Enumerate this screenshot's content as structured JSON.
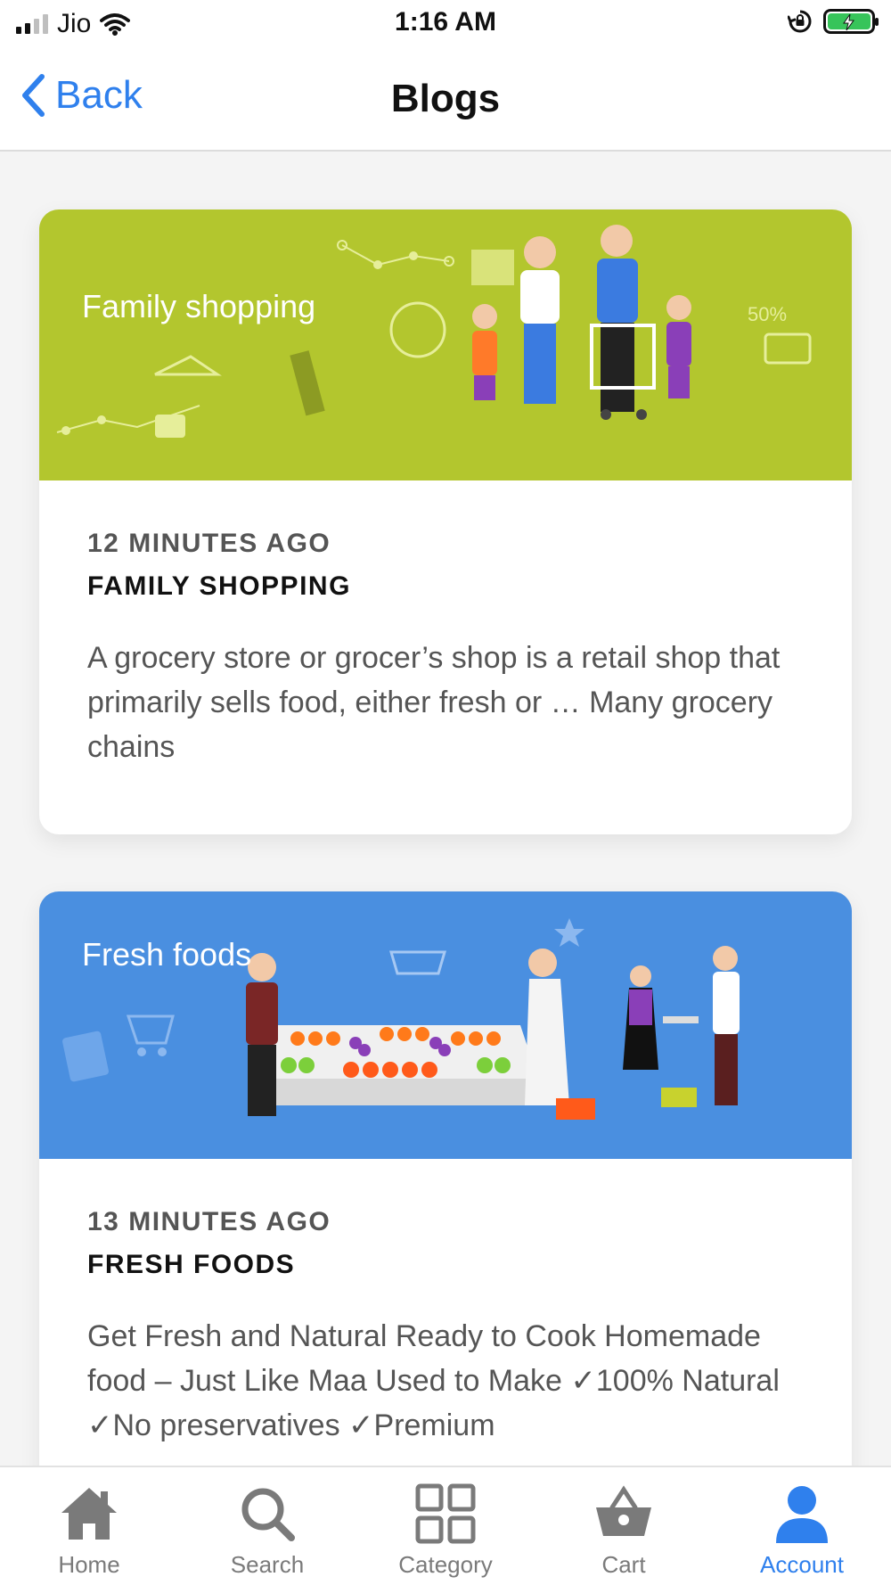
{
  "status_bar": {
    "carrier": "Jio",
    "time": "1:16 AM"
  },
  "nav": {
    "back_label": "Back",
    "title": "Blogs"
  },
  "posts": [
    {
      "banner_title": "Family shopping",
      "time_ago": "12 MINUTES AGO",
      "title": "FAMILY SHOPPING",
      "excerpt": "A grocery store or grocer’s shop is a retail shop that primarily sells food, either fresh or … Many grocery chains",
      "banner_color": "#b3c62e"
    },
    {
      "banner_title": "Fresh foods",
      "time_ago": "13 MINUTES AGO",
      "title": "FRESH FOODS",
      "excerpt": "Get Fresh and Natural Ready to Cook Homemade food – Just Like Maa Used to Make ✓100% Natural ✓No preservatives ✓Premium",
      "banner_color": "#4a8fe0"
    }
  ],
  "tabs": [
    {
      "label": "Home",
      "icon": "home-icon",
      "active": false
    },
    {
      "label": "Search",
      "icon": "search-icon",
      "active": false
    },
    {
      "label": "Category",
      "icon": "category-grid-icon",
      "active": false
    },
    {
      "label": "Cart",
      "icon": "basket-icon",
      "active": false
    },
    {
      "label": "Account",
      "icon": "account-icon",
      "active": true
    }
  ],
  "colors": {
    "accent": "#2f80ed",
    "inactive": "#7a7a7a",
    "battery": "#37c45a"
  }
}
